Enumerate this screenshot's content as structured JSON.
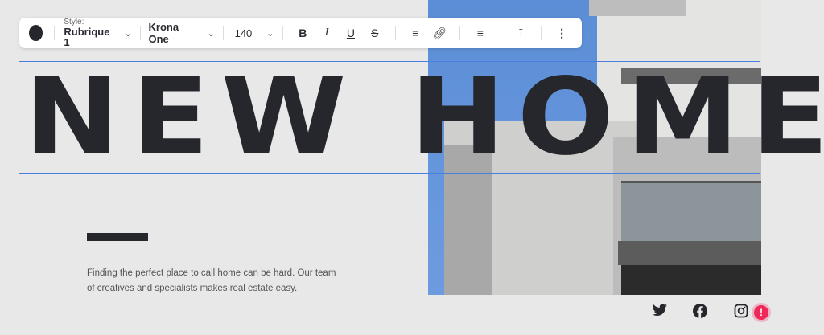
{
  "toolbar": {
    "style_label": "Style:",
    "style_value": "Rubrique 1",
    "font": "Krona One",
    "size": "140",
    "text_color": "#26272c",
    "buttons": {
      "bold": "B",
      "italic": "I",
      "underline": "U",
      "strike": "S"
    }
  },
  "headline": "NEW HOME",
  "paragraph": "Finding the perfect place to call home can be hard. Our team of creatives and specialists makes real estate easy.",
  "alert": "!",
  "colors": {
    "accent": "#4a7fe0",
    "alert": "#f0285a"
  }
}
